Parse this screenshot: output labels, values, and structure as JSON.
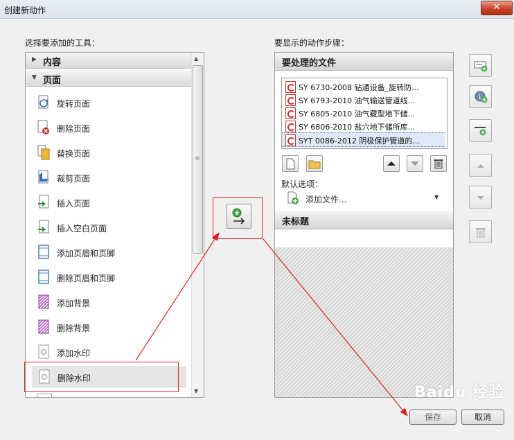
{
  "window": {
    "title": "创建新动作",
    "close_glyph": "✕"
  },
  "left": {
    "caption": "选择要添加的工具：",
    "sections": [
      {
        "label": "内容",
        "expanded": false
      },
      {
        "label": "页面",
        "expanded": true
      }
    ],
    "tools": [
      {
        "label": "旋转页面",
        "icon": "rotate-page-icon"
      },
      {
        "label": "删除页面",
        "icon": "delete-page-icon"
      },
      {
        "label": "替换页面",
        "icon": "replace-page-icon"
      },
      {
        "label": "裁剪页面",
        "icon": "crop-page-icon"
      },
      {
        "label": "插入页面",
        "icon": "insert-page-icon"
      },
      {
        "label": "插入空白页面",
        "icon": "insert-blank-page-icon"
      },
      {
        "label": "添加页眉和页脚",
        "icon": "add-header-footer-icon"
      },
      {
        "label": "删除页眉和页脚",
        "icon": "remove-header-footer-icon"
      },
      {
        "label": "添加背景",
        "icon": "add-background-icon"
      },
      {
        "label": "删除背景",
        "icon": "remove-background-icon"
      },
      {
        "label": "添加水印",
        "icon": "add-watermark-icon"
      },
      {
        "label": "删除水印",
        "icon": "remove-watermark-icon",
        "selected": true
      }
    ]
  },
  "right": {
    "caption": "要显示的动作步骤：",
    "files_header": "要处理的文件",
    "files": [
      {
        "name": "SY 6730-2008 钻通设备_旋转防..."
      },
      {
        "name": "SY 6793-2010 油气输送管道线..."
      },
      {
        "name": "SY 6805-2010 油气藏型地下储..."
      },
      {
        "name": "SY 6806-2010 盐穴地下储所库..."
      },
      {
        "name": "SYT 0086-2012 阴极保护管道的...",
        "selected": true
      }
    ],
    "default_options_label": "默认选项：",
    "add_files_label": "添加文件...",
    "untitled_header": "未标题"
  },
  "buttons": {
    "save": "保存",
    "cancel": "取消"
  },
  "watermark": {
    "text": "Baidu 经验"
  },
  "colors": {
    "annotation_red": "#e02020",
    "pdf_red": "#c9302c",
    "selection_blue": "#dfe9f5"
  }
}
